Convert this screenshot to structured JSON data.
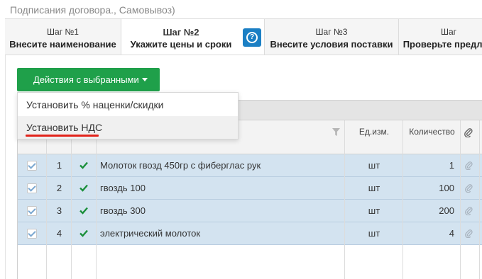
{
  "breadcrumb": "Подписания договора., Самовывоз)",
  "steps": [
    {
      "num": "Шаг №1",
      "title": "Внесите наименование"
    },
    {
      "num": "Шаг №2",
      "title": "Укажите цены и сроки"
    },
    {
      "num": "Шаг №3",
      "title": "Внесите условия поставки"
    },
    {
      "num": "Шаг",
      "title": "Проверьте предлож"
    }
  ],
  "help_icon": "?",
  "actions_button": "Действия с выбранными",
  "dropdown": {
    "items": [
      "Установить % наценки/скидки",
      "Установить НДС"
    ]
  },
  "columns": {
    "unit": "Ед.изм.",
    "quantity": "Количество"
  },
  "rows": [
    {
      "num": "1",
      "name": "Молоток гвозд 450гр с фиберглас рук",
      "unit": "шт",
      "qty": "1"
    },
    {
      "num": "2",
      "name": "гвоздь 100",
      "unit": "шт",
      "qty": "100"
    },
    {
      "num": "3",
      "name": "гвоздь 300",
      "unit": "шт",
      "qty": "200"
    },
    {
      "num": "4",
      "name": "электрический молоток",
      "unit": "шт",
      "qty": "4"
    }
  ],
  "colors": {
    "accent_green": "#1fa04a",
    "help_blue": "#1b7fc4",
    "row_selected": "#d3e3f0",
    "underline_red": "#e2231a"
  },
  "icons": [
    "help-icon",
    "caret-down-icon",
    "filter-icon",
    "paperclip-icon",
    "checkbox-icon",
    "check-icon"
  ]
}
